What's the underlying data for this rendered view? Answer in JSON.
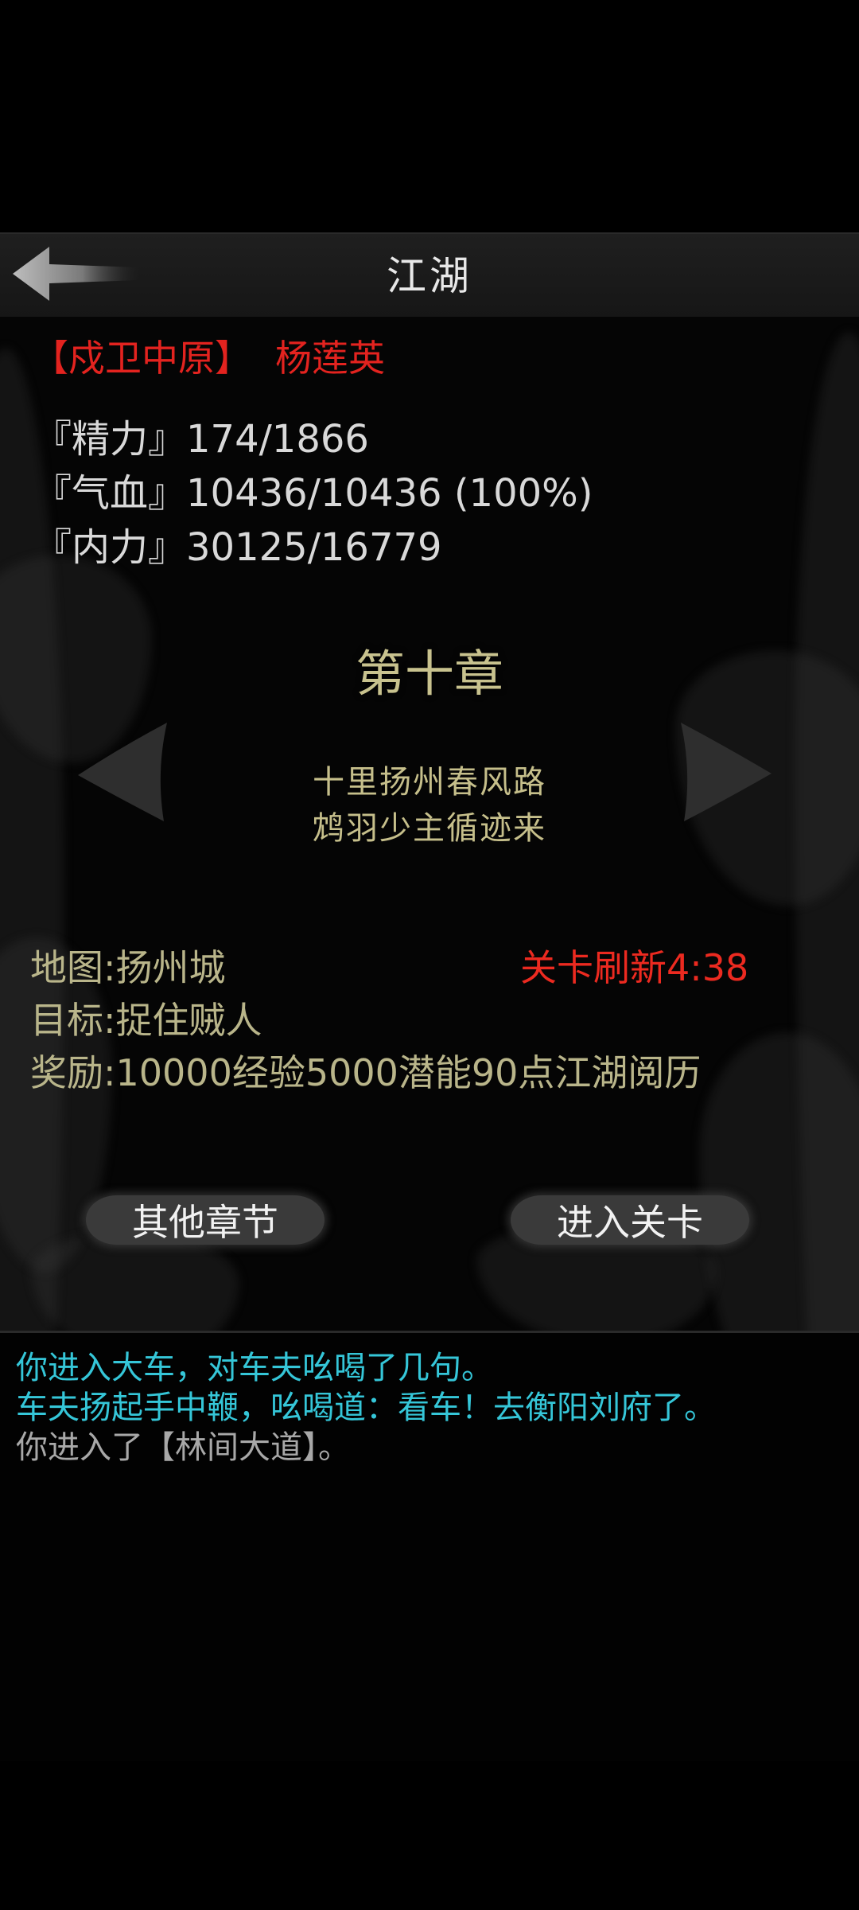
{
  "header": {
    "title": "江湖"
  },
  "hero": {
    "faction": "【戍卫中原】",
    "name": "杨莲英"
  },
  "stats": {
    "energy": "『精力』174/1866",
    "health": "『气血』10436/10436 (100%)",
    "inner_power": "『内力』30125/16779"
  },
  "chapter": {
    "title": "第十章",
    "verse_1": "十里扬州春风路",
    "verse_2": "鸩羽少主循迹来"
  },
  "stage": {
    "map": "地图:扬州城",
    "goal": "目标:捉住贼人",
    "reward": "奖励:10000经验5000潜能90点江湖阅历",
    "refresh": "关卡刷新4:38"
  },
  "buttons": {
    "other_chapters": "其他章节",
    "enter_stage": "进入关卡"
  },
  "log": [
    {
      "text": "你进入大车，对车夫吆喝了几句。",
      "color": "#35c6d8"
    },
    {
      "text": "车夫扬起手中鞭，吆喝道：看车！去衡阳刘府了。",
      "color": "#35c6d8"
    },
    {
      "text": "你进入了【林间大道】。",
      "color": "#a8a8a8"
    }
  ],
  "colors": {
    "hero_red": "#e3231f",
    "refresh_red": "#ec2a20",
    "chapter_gold": "#c8c28e",
    "log_cyan": "#35c6d8",
    "log_gray": "#a8a8a8"
  }
}
